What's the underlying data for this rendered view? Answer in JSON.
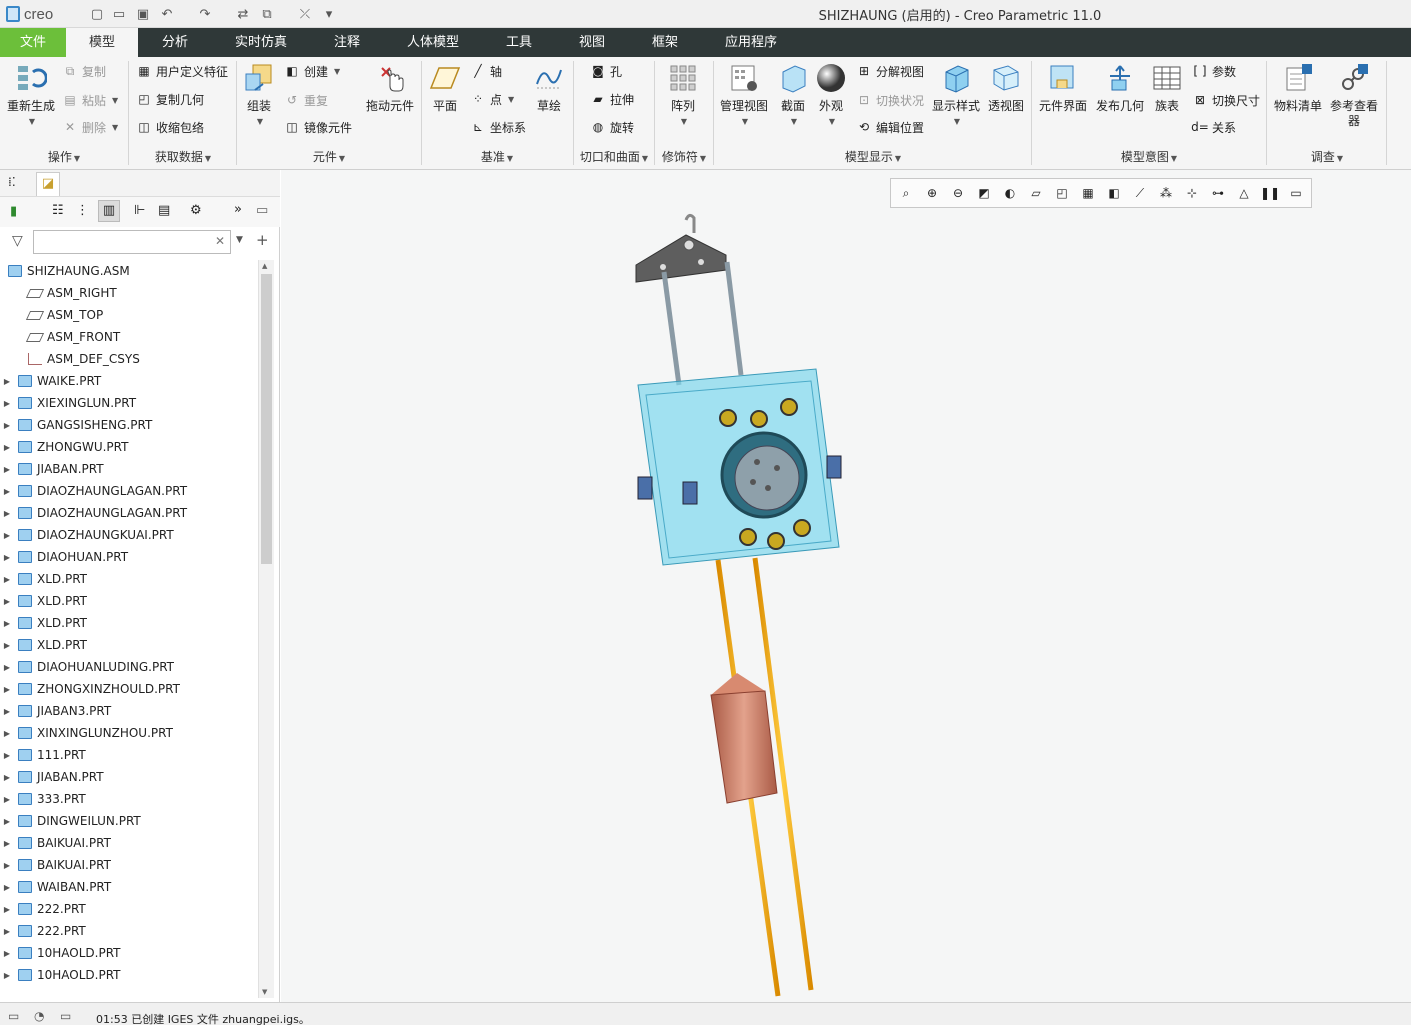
{
  "app": {
    "logo_text": "creo",
    "title": "SHIZHAUNG (启用的) - Creo Parametric 11.0"
  },
  "tabs": [
    {
      "label": "文件"
    },
    {
      "label": "模型"
    },
    {
      "label": "分析"
    },
    {
      "label": "实时仿真"
    },
    {
      "label": "注释"
    },
    {
      "label": "人体模型"
    },
    {
      "label": "工具"
    },
    {
      "label": "视图"
    },
    {
      "label": "框架"
    },
    {
      "label": "应用程序"
    }
  ],
  "ribbon": {
    "regenerate": "重新生成",
    "copy": "复制",
    "paste": "粘贴",
    "delete": "删除",
    "group_operations": "操作",
    "user_defined_feature": "用户定义特征",
    "copy_geometry": "复制几何",
    "shrinkwrap": "收缩包络",
    "group_get_data": "获取数据",
    "assemble": "组装",
    "create": "创建",
    "repeat": "重复",
    "mirror_component": "镜像元件",
    "drag_components": "拖动元件",
    "group_component": "元件",
    "plane": "平面",
    "axis": "轴",
    "point": "点",
    "csys": "坐标系",
    "sketch": "草绘",
    "group_datum": "基准",
    "hole": "孔",
    "extrude": "拉伸",
    "revolve": "旋转",
    "group_cut_surface": "切口和曲面",
    "pattern": "阵列",
    "group_modifiers": "修饰符",
    "manage_views": "管理视图",
    "section": "截面",
    "appearance": "外观",
    "exploded_view": "分解视图",
    "toggle_status": "切换状况",
    "edit_position": "编辑位置",
    "display_style": "显示样式",
    "perspective": "透视图",
    "group_model_display": "模型显示",
    "component_interface": "元件界面",
    "publish_geometry": "发布几何",
    "family_table": "族表",
    "parameters": "参数",
    "switch_dimensions": "切换尺寸",
    "relations": "关系",
    "group_model_intent": "模型意图",
    "bom": "物料清单",
    "reference_viewer": "参考查看器",
    "group_investigate": "调查"
  },
  "filter": {
    "placeholder": ""
  },
  "tree": [
    {
      "label": "SHIZHAUNG.ASM",
      "type": "asm"
    },
    {
      "label": "ASM_RIGHT",
      "type": "plane"
    },
    {
      "label": "ASM_TOP",
      "type": "plane"
    },
    {
      "label": "ASM_FRONT",
      "type": "plane"
    },
    {
      "label": "ASM_DEF_CSYS",
      "type": "csys"
    },
    {
      "label": "WAIKE.PRT",
      "type": "prt"
    },
    {
      "label": "XIEXINGLUN.PRT",
      "type": "prt"
    },
    {
      "label": "GANGSISHENG.PRT",
      "type": "prt"
    },
    {
      "label": "ZHONGWU.PRT",
      "type": "prt"
    },
    {
      "label": "JIABAN.PRT",
      "type": "prt"
    },
    {
      "label": "DIAOZHAUNGLAGAN.PRT",
      "type": "prt"
    },
    {
      "label": "DIAOZHAUNGLAGAN.PRT",
      "type": "prt"
    },
    {
      "label": "DIAOZHAUNGKUAI.PRT",
      "type": "prt"
    },
    {
      "label": "DIAOHUAN.PRT",
      "type": "prt"
    },
    {
      "label": "XLD.PRT",
      "type": "prt"
    },
    {
      "label": "XLD.PRT",
      "type": "prt"
    },
    {
      "label": "XLD.PRT",
      "type": "prt"
    },
    {
      "label": "XLD.PRT",
      "type": "prt"
    },
    {
      "label": "DIAOHUANLUDING.PRT",
      "type": "prt"
    },
    {
      "label": "ZHONGXINZHOULD.PRT",
      "type": "prt"
    },
    {
      "label": "JIABAN3.PRT",
      "type": "prt"
    },
    {
      "label": "XINXINGLUNZHOU.PRT",
      "type": "prt"
    },
    {
      "label": "111.PRT",
      "type": "prt"
    },
    {
      "label": "JIABAN.PRT",
      "type": "prt"
    },
    {
      "label": "333.PRT",
      "type": "prt"
    },
    {
      "label": "DINGWEILUN.PRT",
      "type": "prt"
    },
    {
      "label": "BAIKUAI.PRT",
      "type": "prt"
    },
    {
      "label": "BAIKUAI.PRT",
      "type": "prt"
    },
    {
      "label": "WAIBAN.PRT",
      "type": "prt"
    },
    {
      "label": "222.PRT",
      "type": "prt"
    },
    {
      "label": "222.PRT",
      "type": "prt"
    },
    {
      "label": "10HAOLD.PRT",
      "type": "prt"
    },
    {
      "label": "10HAOLD.PRT",
      "type": "prt"
    }
  ],
  "status": {
    "message": "01:53 已创建 IGES 文件 zhuangpei.igs。"
  },
  "colors": {
    "file_tab": "#6cbf3a",
    "tabbar": "#2f3838",
    "accent": "#3a88c8"
  }
}
